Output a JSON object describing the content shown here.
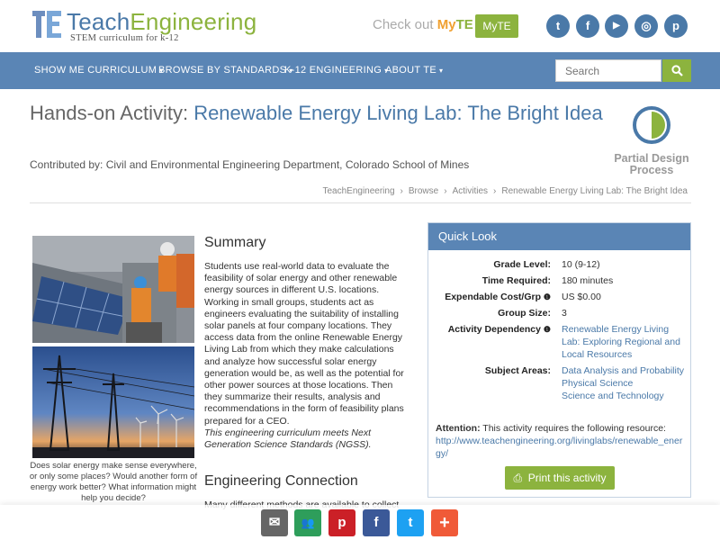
{
  "header": {
    "logo_teach": "Teach",
    "logo_engineering": "Engineering",
    "logo_tagline": "STEM curriculum for k-12",
    "checkout_text": "Check out",
    "myte_my": "My",
    "myte_te": "TE",
    "myte_button": "MyTE",
    "social": [
      {
        "icon": "twitter-icon",
        "glyph": "t"
      },
      {
        "icon": "facebook-icon",
        "glyph": "f"
      },
      {
        "icon": "youtube-icon",
        "glyph": "▶"
      },
      {
        "icon": "instagram-icon",
        "glyph": "◎"
      },
      {
        "icon": "pinterest-icon",
        "glyph": "p"
      }
    ]
  },
  "nav": {
    "items": [
      "SHOW ME CURRICULUM",
      "BROWSE BY STANDARDS",
      "K-12 ENGINEERING",
      "ABOUT TE"
    ],
    "search_placeholder": "Search"
  },
  "page": {
    "title_prefix": "Hands-on Activity: ",
    "title_main": "Renewable Energy Living Lab: The Bright Idea",
    "contributed": "Contributed by: Civil and Environmental Engineering Department, Colorado School of Mines",
    "badge_line1": "Partial Design",
    "badge_line2": "Process",
    "breadcrumb": [
      "TeachEngineering",
      "Browse",
      "Activities",
      "Renewable Energy Living Lab: The Bright Idea"
    ]
  },
  "media": {
    "caption": "Does solar energy make sense everywhere, or only some places? Would another form of energy work better? What information might help you decide?"
  },
  "summary": {
    "heading": "Summary",
    "body": "Students use real-world data to evaluate the feasibility of solar energy and other renewable energy sources in different U.S. locations. Working in small groups, students act as engineers evaluating the suitability of installing solar panels at four company locations. They access data from the online Renewable Energy Living Lab from which they make calculations and analyze how successful solar energy generation would be, as well as the potential for other power sources at those locations. Then they summarize their results, analysis and recommendations in the form of feasibility plans prepared for a CEO.",
    "ngss": "This engineering curriculum meets Next Generation Science Standards (NGSS).",
    "eng_heading": "Engineering Connection",
    "eng_body": "Many different methods are available to collect"
  },
  "quick_look": {
    "heading": "Quick Look",
    "grade_label": "Grade Level:",
    "grade_value": "10 (9-12)",
    "time_label": "Time Required:",
    "time_value": "180 minutes",
    "cost_label": "Expendable Cost/Grp",
    "cost_value": "US $0.00",
    "group_label": "Group Size:",
    "group_value": "3",
    "dependency_label": "Activity Dependency",
    "dependency_value": "Renewable Energy Living Lab: Exploring Regional and Local Resources",
    "subject_label": "Subject Areas:",
    "subjects": [
      "Data Analysis and Probability",
      "Physical Science",
      "Science and Technology"
    ],
    "attention_label": "Attention:",
    "attention_text": " This activity requires the following resource:",
    "attention_link": "http://www.teachengineering.org/livinglabs/renewable_energy/",
    "print_label": "Print this activity"
  },
  "share": [
    {
      "icon": "email-icon",
      "glyph": "✉",
      "color": "#666666"
    },
    {
      "icon": "google-classroom-icon",
      "glyph": "👥",
      "color": "#2e9e5b"
    },
    {
      "icon": "pinterest-icon",
      "glyph": "p",
      "color": "#cb2027"
    },
    {
      "icon": "facebook-icon",
      "glyph": "f",
      "color": "#3b5998"
    },
    {
      "icon": "twitter-icon",
      "glyph": "t",
      "color": "#1da1f2"
    },
    {
      "icon": "more-icon",
      "glyph": "+",
      "color": "#f05a38"
    }
  ]
}
